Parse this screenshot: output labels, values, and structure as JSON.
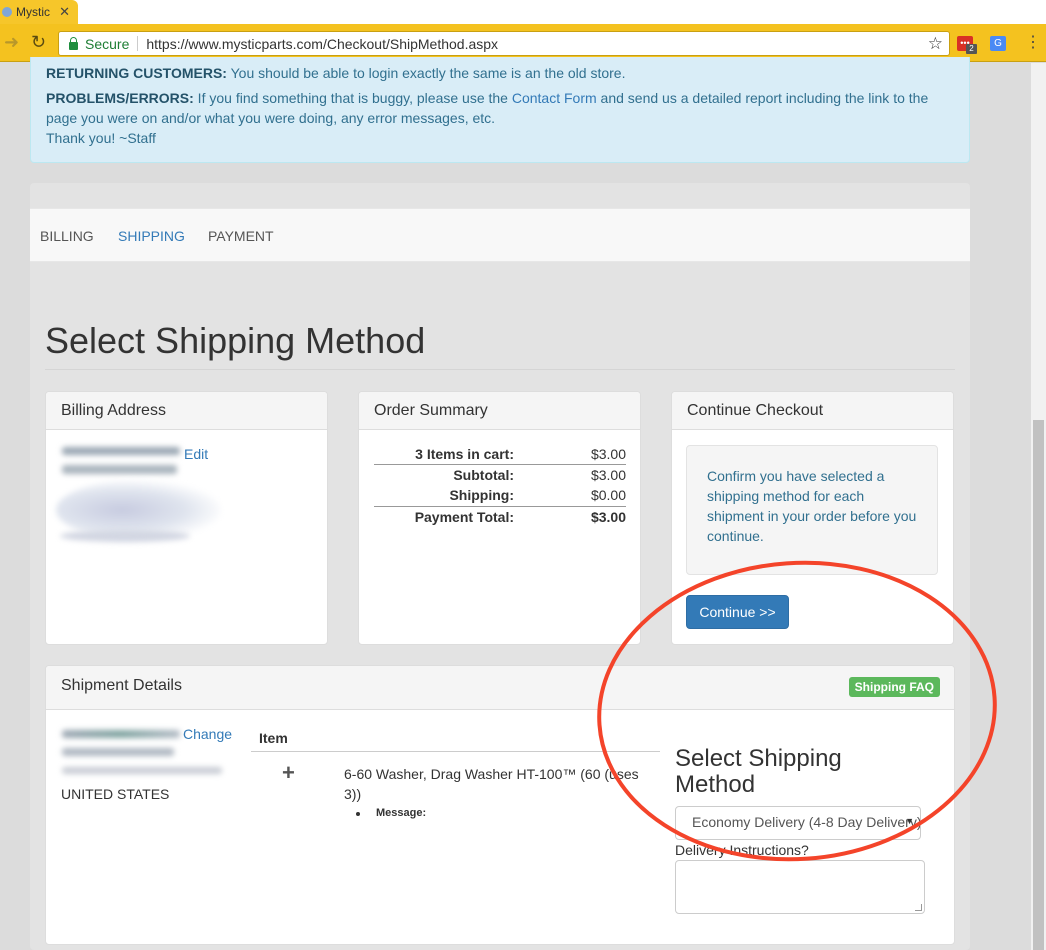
{
  "browser": {
    "tab_title": "Mystic",
    "tab_close": "✕",
    "secure_label": "Secure",
    "url": "https://www.mysticparts.com/Checkout/ShipMethod.aspx",
    "ext_badge": "2"
  },
  "notice": {
    "returning_label": "RETURNING CUSTOMERS:",
    "returning_text": " You should be able to login exactly the same is an the old store.",
    "problems_label": "PROBLEMS/ERRORS:",
    "problems_text_1": " If you find something that is buggy, please use the ",
    "contact_link": "Contact Form",
    "problems_text_2": " and send us a detailed report including the link to the page you were on and/or what you were doing, any error messages, etc.",
    "thanks": "Thank you! ~Staff"
  },
  "steps": {
    "billing": "BILLING",
    "shipping": "SHIPPING",
    "payment": "PAYMENT",
    "active": "shipping"
  },
  "page_title": "Select Shipping Method",
  "billing": {
    "heading": "Billing Address",
    "edit_label": "Edit"
  },
  "order_summary": {
    "heading": "Order Summary",
    "rows": [
      {
        "label": "3 Items in cart:",
        "value": "$3.00"
      },
      {
        "label": "Subtotal:",
        "value": "$3.00"
      },
      {
        "label": "Shipping:",
        "value": "$0.00"
      },
      {
        "label": "Payment Total:",
        "value": "$3.00"
      }
    ]
  },
  "continue_checkout": {
    "heading": "Continue Checkout",
    "note": "Confirm you have selected a shipping method for each shipment in your order before you continue.",
    "button_label": "Continue >>"
  },
  "shipment": {
    "heading": "Shipment Details",
    "faq_label": "Shipping FAQ",
    "change_label": "Change",
    "country": "UNITED STATES",
    "item_header": "Item",
    "item_description": "6-60 Washer, Drag Washer HT-100™ (60 (uses 3))",
    "message_label": "Message:",
    "select_title": "Select Shipping Method",
    "selected_method": "Economy Delivery (4-8 Day Delivery)",
    "delivery_label": "Delivery Instructions?",
    "delivery_value": ""
  },
  "colors": {
    "chrome_theme": "#f4c21f",
    "link": "#337ab7",
    "primary_button": "#337ab7",
    "faq_button": "#5cb85c",
    "annotation": "#f4442a"
  }
}
